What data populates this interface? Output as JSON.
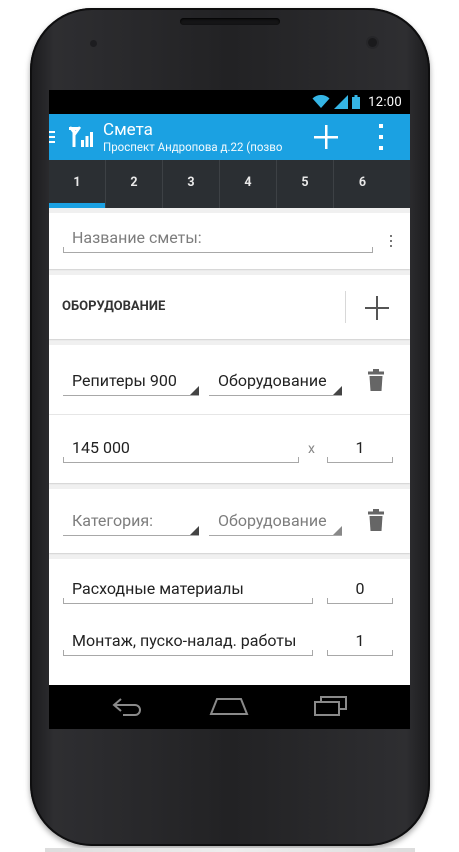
{
  "status_bar": {
    "time": "12:00"
  },
  "action_bar": {
    "title": "Смета",
    "subtitle": "Проспект Андропова д.22 (позво"
  },
  "tabs": [
    "1",
    "2",
    "3",
    "4",
    "5",
    "6"
  ],
  "active_tab": "1",
  "estimate": {
    "name_placeholder": "Название сметы:"
  },
  "equipment_section": {
    "label": "ОБОРУДОВАНИЕ"
  },
  "equipment_item": {
    "name": "Репитеры 900",
    "type": "Оборудование",
    "price": "145 000",
    "multiply": "x",
    "quantity": "1"
  },
  "category_row": {
    "category_placeholder": "Категория:",
    "type": "Оборудование"
  },
  "extras": [
    {
      "label": "Расходные материалы",
      "value": "0"
    },
    {
      "label": "Монтаж, пуско-налад. работы",
      "value": "1"
    }
  ],
  "colors": {
    "accent": "#1ba1e2",
    "tabs_bg": "#2b2f33",
    "phone_body": "#222224"
  }
}
